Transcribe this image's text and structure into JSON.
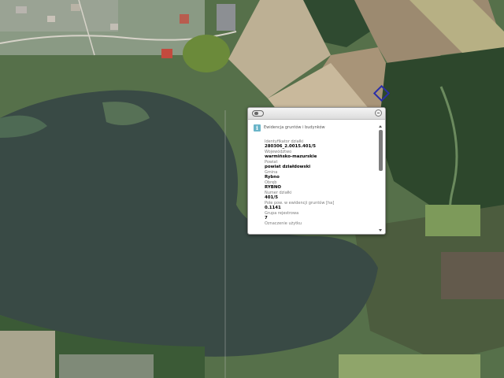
{
  "map": {
    "parcel_outline_color": "#2a2fa8",
    "water_color": "#3b4c47",
    "forest_color": "#2d4a2c",
    "field_color": "#c8b89a"
  },
  "popup": {
    "icon": "info-icon",
    "title": "Ewidencja gruntów i budynków",
    "fields": [
      {
        "label": "Identyfikator działki",
        "value": "280306_2.0015.401/5"
      },
      {
        "label": "Województwo",
        "value": "warmińsko-mazurskie"
      },
      {
        "label": "Powiat",
        "value": "powiat działdowski"
      },
      {
        "label": "Gmina",
        "value": "Rybno"
      },
      {
        "label": "Obręb",
        "value": "RYBNO"
      },
      {
        "label": "Numer działki",
        "value": "401/5"
      },
      {
        "label": "Pole pow. w ewidencji gruntów [ha]",
        "value": "0.1141"
      },
      {
        "label": "Grupa rejestrowa",
        "value": "7"
      },
      {
        "label": "Oznaczenie użytku",
        "value": ""
      }
    ]
  }
}
